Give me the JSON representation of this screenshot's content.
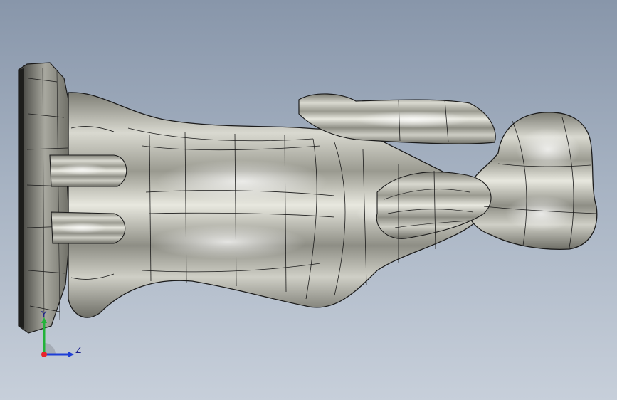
{
  "viewport": {
    "background_top": "#8896aa",
    "background_bottom": "#c7cfda",
    "model_color": "#b8b8ad",
    "edge_color": "#1b1b1b"
  },
  "triad": {
    "x_axis_color": "#e8242c",
    "y_axis_color": "#22b33a",
    "z_axis_color": "#1e3ed6",
    "y_label": "Y",
    "z_label": "Z",
    "icon": "coordinate-triad-icon"
  }
}
